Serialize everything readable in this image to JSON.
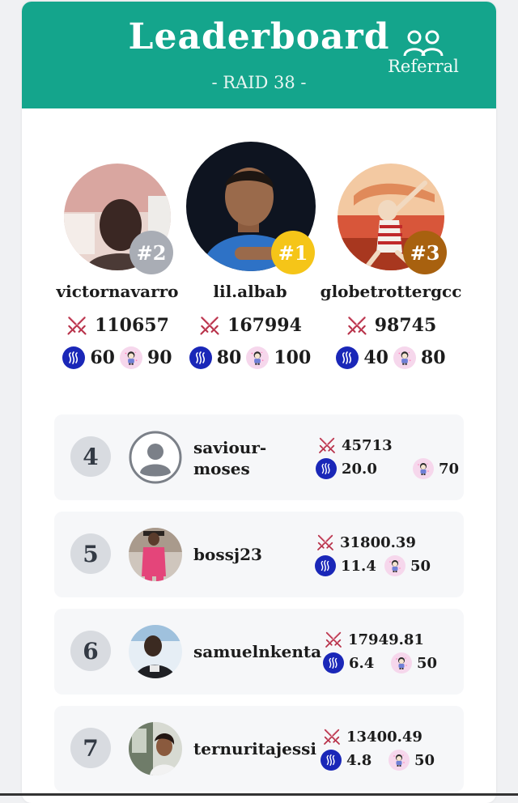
{
  "header": {
    "title": "Leaderboard",
    "subtitle": "- RAID 38 -",
    "referral_label": "Referral"
  },
  "colors": {
    "header_bg": "#14a58c",
    "rank1_badge": "#f5c518",
    "rank2_badge": "#a9adb5",
    "rank3_badge": "#a8610f",
    "steem_token": "#1a27b8"
  },
  "icons": {
    "score": "crossed-swords-icon",
    "token_a": "steem-token-icon",
    "token_b": "pet-token-icon",
    "referral": "users-icon"
  },
  "podium": [
    {
      "rank": "#2",
      "name": "victornavarro",
      "score": "110657",
      "steem": "60",
      "pet": "90"
    },
    {
      "rank": "#1",
      "name": "lil.albab",
      "score": "167994",
      "steem": "80",
      "pet": "100"
    },
    {
      "rank": "#3",
      "name": "globetrottergcc",
      "score": "98745",
      "steem": "40",
      "pet": "80"
    }
  ],
  "rows": [
    {
      "rank": "4",
      "name_line1": "saviour-",
      "name_line2": "moses",
      "score": "45713",
      "steem": "20.0",
      "pet": "70"
    },
    {
      "rank": "5",
      "name": "bossj23",
      "score": "31800.39",
      "steem": "11.4",
      "pet": "50"
    },
    {
      "rank": "6",
      "name": "samuelnkenta",
      "score": "17949.81",
      "steem": "6.4",
      "pet": "50"
    },
    {
      "rank": "7",
      "name": "ternuritajessi",
      "score": "13400.49",
      "steem": "4.8",
      "pet": "50"
    }
  ]
}
